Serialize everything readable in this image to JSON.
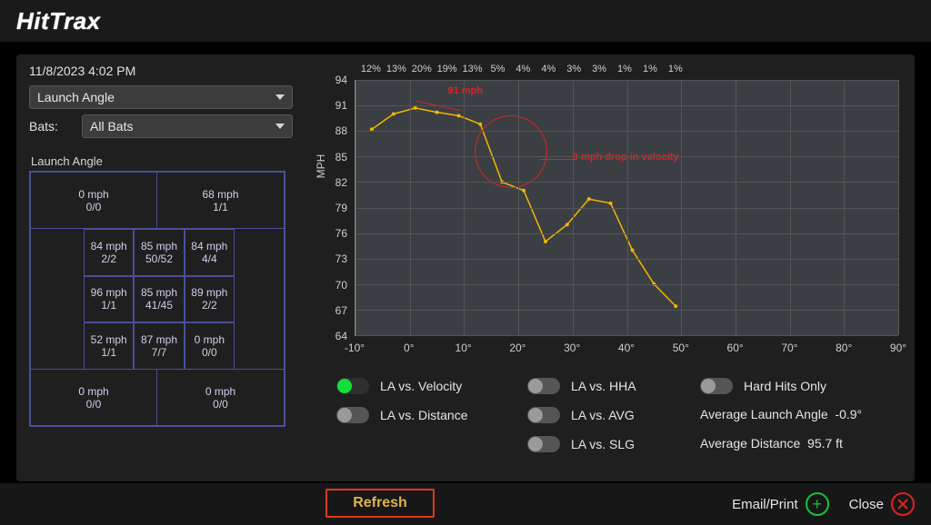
{
  "brand": "HitTrax",
  "timestamp": "11/8/2023 4:02 PM",
  "metric_select": "Launch Angle",
  "bats_label": "Bats:",
  "bats_select": "All Bats",
  "zone_title": "Launch Angle",
  "zone": {
    "outer": {
      "top_left": {
        "mph": "0 mph",
        "ab": "0/0"
      },
      "top_right": {
        "mph": "68 mph",
        "ab": "1/1"
      },
      "bot_left": {
        "mph": "0 mph",
        "ab": "0/0"
      },
      "bot_right": {
        "mph": "0 mph",
        "ab": "0/0"
      }
    },
    "inner": [
      {
        "mph": "84 mph",
        "ab": "2/2"
      },
      {
        "mph": "85 mph",
        "ab": "50/52"
      },
      {
        "mph": "84 mph",
        "ab": "4/4"
      },
      {
        "mph": "96 mph",
        "ab": "1/1"
      },
      {
        "mph": "85 mph",
        "ab": "41/45"
      },
      {
        "mph": "89 mph",
        "ab": "2/2"
      },
      {
        "mph": "52 mph",
        "ab": "1/1"
      },
      {
        "mph": "87 mph",
        "ab": "7/7"
      },
      {
        "mph": "0 mph",
        "ab": "0/0"
      }
    ]
  },
  "chart_data": {
    "type": "line",
    "ylabel": "MPH",
    "ylim": [
      64,
      94
    ],
    "xlim": [
      -10,
      90
    ],
    "yticks": [
      94,
      91,
      88,
      85,
      82,
      79,
      76,
      73,
      70,
      67,
      64
    ],
    "xticks": [
      -10,
      0,
      10,
      20,
      30,
      40,
      50,
      60,
      70,
      80,
      90
    ],
    "top_percents": [
      "12%",
      "13%",
      "20%",
      "19%",
      "13%",
      "5%",
      "4%",
      "4%",
      "3%",
      "3%",
      "1%",
      "1%",
      "1%"
    ],
    "series": [
      {
        "name": "LA vs. Velocity",
        "points": [
          {
            "x": -7,
            "y": 88.2
          },
          {
            "x": -3,
            "y": 90.0
          },
          {
            "x": 1,
            "y": 90.7
          },
          {
            "x": 5,
            "y": 90.2
          },
          {
            "x": 9,
            "y": 89.8
          },
          {
            "x": 13,
            "y": 88.8
          },
          {
            "x": 17,
            "y": 82.0
          },
          {
            "x": 21,
            "y": 81.0
          },
          {
            "x": 25,
            "y": 75.0
          },
          {
            "x": 29,
            "y": 77.0
          },
          {
            "x": 33,
            "y": 80.0
          },
          {
            "x": 37,
            "y": 79.5
          },
          {
            "x": 41,
            "y": 74.0
          },
          {
            "x": 45,
            "y": 70.0
          },
          {
            "x": 49,
            "y": 67.4
          }
        ]
      }
    ],
    "annotations": [
      {
        "text": "91 mph",
        "x": 8,
        "y": 91.5,
        "id": "peak"
      },
      {
        "text": "9 mph drop in velocity",
        "x": 28,
        "y": 85,
        "id": "drop"
      }
    ]
  },
  "toggles": {
    "la_velocity": "LA vs. Velocity",
    "la_distance": "LA vs. Distance",
    "la_hha": "LA vs. HHA",
    "la_avg": "LA vs. AVG",
    "la_slg": "LA vs. SLG",
    "hard_hits": "Hard Hits Only"
  },
  "summary": {
    "avg_la_label": "Average Launch Angle",
    "avg_la_value": "-0.9°",
    "avg_dist_label": "Average Distance",
    "avg_dist_value": "95.7 ft"
  },
  "buttons": {
    "refresh": "Refresh",
    "email": "Email/Print",
    "close": "Close"
  }
}
